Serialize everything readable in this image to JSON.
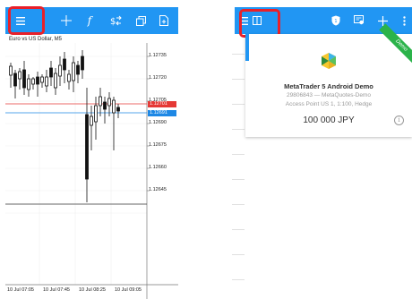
{
  "chart": {
    "title": "Euro vs US Dollar, M5",
    "y_labels": [
      "1.12735",
      "1.12720",
      "1.12705",
      "1.12690",
      "1.12675",
      "1.12660",
      "1.12645"
    ],
    "bid_tag": "1.12701",
    "ask_tag": "1.12691",
    "x_labels": [
      "10 Jul 07:05",
      "10 Jul 07:45",
      "10 Jul 08:25",
      "10 Jul 09:05"
    ],
    "colors": {
      "bid": "#e53935",
      "ask": "#1e88e5",
      "candle": "#111111",
      "grid": "#eeeeee"
    }
  },
  "left_toolbar": {
    "icons": [
      "menu-icon",
      "crosshair-icon",
      "function-icon",
      "dollar-arrows-icon",
      "copy-icon",
      "document-icon"
    ]
  },
  "right_toolbar": {
    "icons": [
      "menu-icon",
      "book-icon",
      "shield-icon",
      "certificate-icon",
      "plus-icon",
      "more-vertical-icon"
    ]
  },
  "account": {
    "name": "MetaTrader 5 Android Demo",
    "login_line": "29806843 — MetaQuotes-Demo",
    "server_line": "Access Point US 1, 1:100, Hedge",
    "balance": "100 000 JPY",
    "ribbon": "Demo"
  },
  "accent": "#2196f3",
  "highlight": "#e8202a"
}
